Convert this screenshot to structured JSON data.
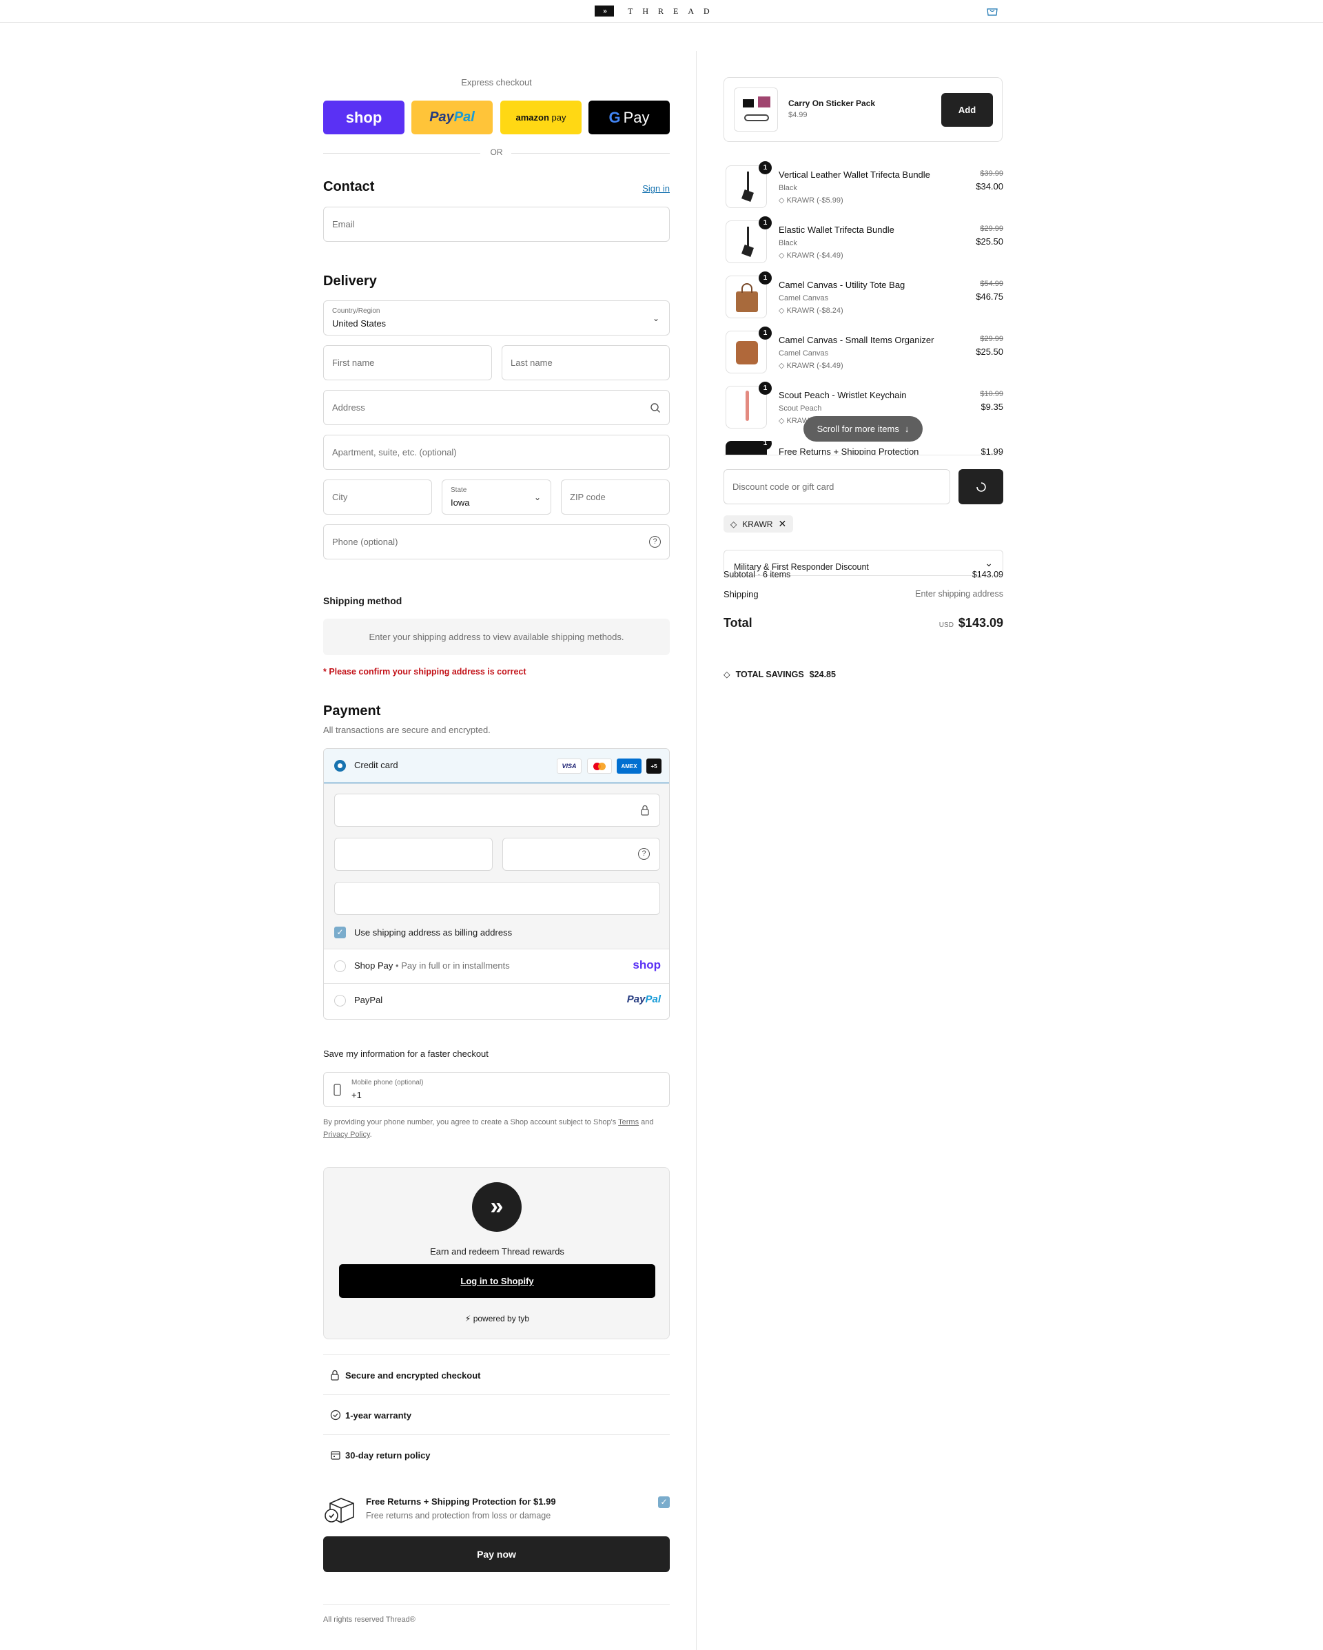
{
  "brand": {
    "name": "THREAD"
  },
  "express": {
    "label": "Express checkout",
    "shop": "shop",
    "paypal_a": "Pay",
    "paypal_b": "Pal",
    "amazon_a": "amazon",
    "amazon_b": "pay",
    "gpay": "Pay",
    "or": "OR"
  },
  "contact": {
    "title": "Contact",
    "sign_in": "Sign in",
    "email_placeholder": "Email"
  },
  "delivery": {
    "title": "Delivery",
    "country_label": "Country/Region",
    "country_value": "United States",
    "first_name": "First name",
    "last_name": "Last name",
    "address": "Address",
    "apartment": "Apartment, suite, etc. (optional)",
    "city": "City",
    "state_label": "State",
    "state_value": "Iowa",
    "zip": "ZIP code",
    "phone": "Phone (optional)"
  },
  "shipping": {
    "title": "Shipping method",
    "message": "Enter your shipping address to view available shipping methods.",
    "warning": "* Please confirm your shipping address is correct"
  },
  "payment": {
    "title": "Payment",
    "subtitle": "All transactions are secure and encrypted.",
    "credit_card": "Credit card",
    "visa": "VISA",
    "amex": "AMEX",
    "more": "+5",
    "billing_same": "Use shipping address as billing address",
    "shop_pay": "Shop Pay",
    "shop_pay_sep": "•",
    "shop_pay_note": "Pay in full or in installments",
    "shop_logo": "shop",
    "paypal": "PayPal",
    "paypal_logo_a": "Pay",
    "paypal_logo_b": "Pal"
  },
  "save_info": {
    "title": "Save my information for a faster checkout",
    "mobile_label": "Mobile phone (optional)",
    "mobile_value": "+1",
    "fine_1": "By providing your phone number, you agree to create a Shop account subject to Shop's ",
    "terms": "Terms",
    "fine_and": " and",
    "privacy": "Privacy Policy",
    "fine_end": "."
  },
  "rewards": {
    "text": "Earn and redeem Thread rewards",
    "button": "Log in to Shopify",
    "powered_icon": "⚡",
    "powered": "powered by tyb"
  },
  "trust": [
    {
      "icon": "lock-icon",
      "label": "Secure and encrypted checkout"
    },
    {
      "icon": "check-circle-icon",
      "label": "1-year warranty"
    },
    {
      "icon": "calendar-icon",
      "label": "30-day return policy"
    }
  ],
  "protection": {
    "title": "Free Returns + Shipping Protection for $1.99",
    "subtitle": "Free returns and protection from loss or damage"
  },
  "pay_now": "Pay now",
  "footer": "All rights reserved Thread®",
  "upsell": {
    "name": "Carry On Sticker Pack",
    "price": "$4.99",
    "button": "Add"
  },
  "items": [
    {
      "qty": "1",
      "name": "Vertical Leather Wallet Trifecta Bundle",
      "variant": "Black",
      "discount": "KRAWR (-$5.99)",
      "original": "$39.99",
      "price": "$34.00"
    },
    {
      "qty": "1",
      "name": "Elastic Wallet Trifecta Bundle",
      "variant": "Black",
      "discount": "KRAWR (-$4.49)",
      "original": "$29.99",
      "price": "$25.50"
    },
    {
      "qty": "1",
      "name": "Camel Canvas - Utility Tote Bag",
      "variant": "Camel Canvas",
      "discount": "KRAWR (-$8.24)",
      "original": "$54.99",
      "price": "$46.75"
    },
    {
      "qty": "1",
      "name": "Camel Canvas - Small Items Organizer",
      "variant": "Camel Canvas",
      "discount": "KRAWR (-$4.49)",
      "original": "$29.99",
      "price": "$25.50"
    },
    {
      "qty": "1",
      "name": "Scout Peach - Wristlet Keychain",
      "variant": "Scout Peach",
      "discount": "KRAWR (-$1.64)",
      "original": "$10.99",
      "price": "$9.35"
    }
  ],
  "last_item": {
    "qty": "1",
    "name": "Free Returns + Shipping Protection",
    "price": "$1.99"
  },
  "scroll_hint": "Scroll for more items",
  "discount": {
    "placeholder": "Discount code or gift card",
    "applied_code": "KRAWR"
  },
  "military": "Military & First Responder Discount",
  "summary": {
    "subtotal_label": "Subtotal · 6 items",
    "subtotal": "$143.09",
    "shipping_label": "Shipping",
    "shipping_value": "Enter shipping address",
    "total_label": "Total",
    "currency": "USD",
    "total": "$143.09",
    "savings_label": "TOTAL SAVINGS",
    "savings": "$24.85"
  },
  "colors": {
    "shop": "#5a31f4",
    "paypal_bg": "#ffc439",
    "amazon_bg": "#ffd814",
    "accent": "#1773b0",
    "warning": "#c3141b"
  }
}
